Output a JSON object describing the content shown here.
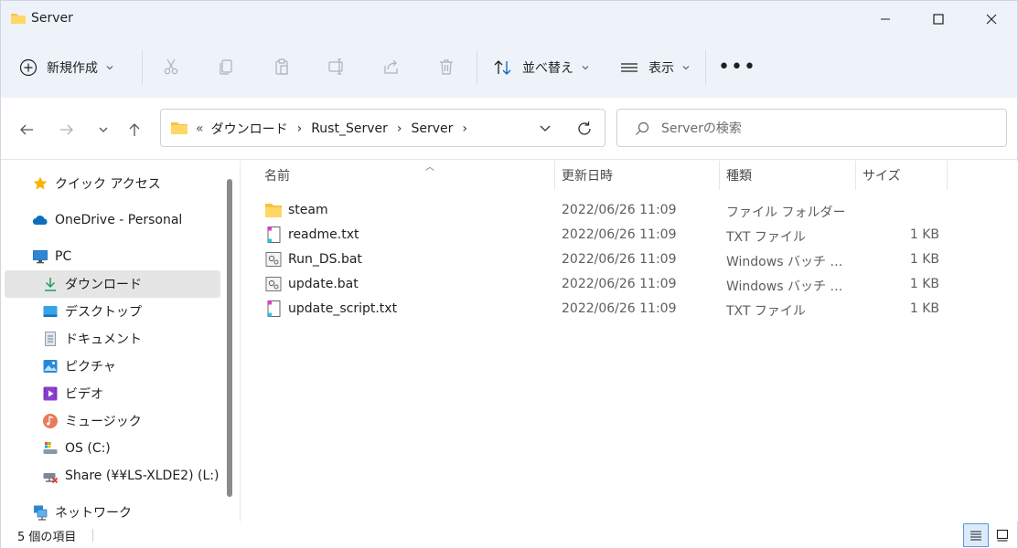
{
  "window": {
    "title": "Server",
    "icon": "folder-icon",
    "controls": [
      "minimize-icon",
      "maximize-icon",
      "close-icon"
    ]
  },
  "toolbar": {
    "new_label": "新規作成",
    "sort_label": "並べ替え",
    "view_label": "表示",
    "more_label": "•••",
    "icons": [
      "cut-icon",
      "copy-icon",
      "paste-icon",
      "rename-icon",
      "share-icon",
      "delete-icon"
    ]
  },
  "nav": {
    "breadcrumb_prefix": "«",
    "breadcrumbs": [
      "ダウンロード",
      "Rust_Server",
      "Server"
    ],
    "crumb_separator": "›",
    "search_placeholder": "Serverの検索"
  },
  "sidebar": {
    "items": [
      {
        "label": "クイック アクセス",
        "icon": "star-icon"
      },
      {
        "label": "OneDrive - Personal",
        "icon": "cloud-icon"
      },
      {
        "label": "PC",
        "icon": "monitor-icon"
      },
      {
        "label": "ダウンロード",
        "icon": "download-icon"
      },
      {
        "label": "デスクトップ",
        "icon": "desktop-icon"
      },
      {
        "label": "ドキュメント",
        "icon": "document-icon"
      },
      {
        "label": "ピクチャ",
        "icon": "pictures-icon"
      },
      {
        "label": "ビデオ",
        "icon": "video-icon"
      },
      {
        "label": "ミュージック",
        "icon": "music-icon"
      },
      {
        "label": "OS (C:)",
        "icon": "drive-icon"
      },
      {
        "label": "Share (¥¥LS-XLDE2) (L:)",
        "icon": "network-drive-disconnected-icon"
      },
      {
        "label": "ネットワーク",
        "icon": "network-icon"
      }
    ],
    "selected": "ダウンロード"
  },
  "columns": {
    "name": "名前",
    "date": "更新日時",
    "type": "種類",
    "size": "サイズ"
  },
  "files": [
    {
      "name": "steam",
      "date": "2022/06/26 11:09",
      "type": "ファイル フォルダー",
      "size": "",
      "icon": "folder-icon"
    },
    {
      "name": "readme.txt",
      "date": "2022/06/26 11:09",
      "type": "TXT ファイル",
      "size": "1 KB",
      "icon": "text-file-icon"
    },
    {
      "name": "Run_DS.bat",
      "date": "2022/06/26 11:09",
      "type": "Windows バッチ ファ...",
      "size": "1 KB",
      "icon": "batch-file-icon"
    },
    {
      "name": "update.bat",
      "date": "2022/06/26 11:09",
      "type": "Windows バッチ ファ...",
      "size": "1 KB",
      "icon": "batch-file-icon"
    },
    {
      "name": "update_script.txt",
      "date": "2022/06/26 11:09",
      "type": "TXT ファイル",
      "size": "1 KB",
      "icon": "text-file-icon"
    }
  ],
  "status": {
    "item_count": "5 個の項目"
  },
  "colors": {
    "chrome_bg": "#eef3fa",
    "folder_yellow": "#f4c542",
    "selected_bg": "#e5e5e5",
    "accent_blue": "#0067c0"
  }
}
